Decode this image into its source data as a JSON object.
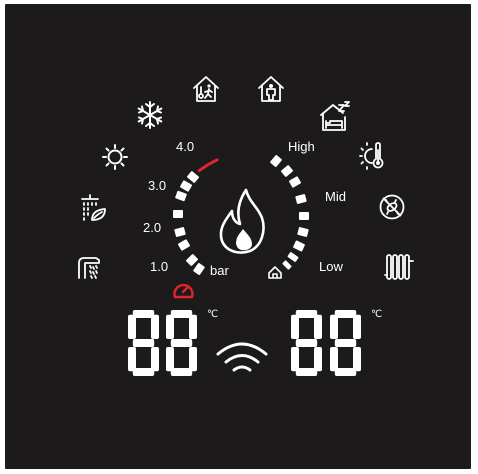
{
  "panel": {
    "background_color": "#1c1a1b",
    "segment_color": "#ffffff",
    "alert_color": "#e0242a"
  },
  "pressure_gauge": {
    "scale_labels": [
      "4.0",
      "3.0",
      "2.0",
      "1.0"
    ],
    "unit": "bar",
    "alarm_icon": "pressure-alarm-icon"
  },
  "flow_gauge": {
    "scale_labels": [
      "High",
      "Mid",
      "Low"
    ],
    "icon": "house-icon"
  },
  "center_icon": "flame-icon",
  "left_display": {
    "digits": "88",
    "unit": "℃"
  },
  "right_display": {
    "digits": "88",
    "unit": "℃"
  },
  "status_icon": "wifi-icon",
  "mode_icons": [
    "tap-water-icon",
    "shower-eco-icon",
    "sun-icon",
    "snowflake-icon",
    "away-home-icon",
    "home-icon",
    "sleep-icon",
    "outdoor-temperature-icon",
    "anti-legionella-icon",
    "radiator-icon"
  ]
}
